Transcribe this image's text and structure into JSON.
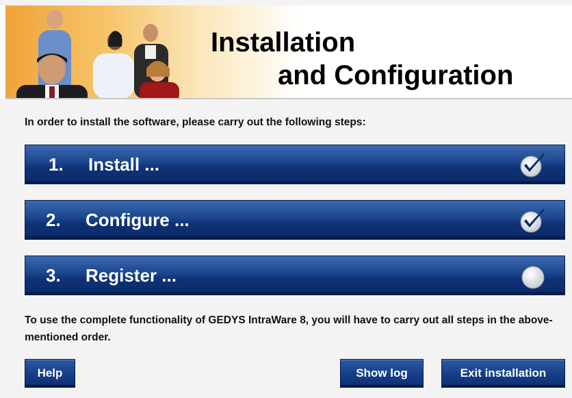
{
  "header": {
    "title_line1": "Installation",
    "title_line2": "and Configuration"
  },
  "intro": "In order to install the software, please carry out the following steps:",
  "steps": [
    {
      "number": "1.",
      "label": "Install ...",
      "status": "completed",
      "status_icon": "checkmark-icon"
    },
    {
      "number": "2.",
      "label": "Configure ...",
      "status": "completed",
      "status_icon": "checkmark-icon"
    },
    {
      "number": "3.",
      "label": "Register ...",
      "status": "pending",
      "status_icon": "empty-circle-icon"
    }
  ],
  "footer_text": "To use the complete functionality of GEDYS IntraWare 8, you will have to carry out all steps in the above-mentioned order.",
  "buttons": {
    "help": "Help",
    "show_log": "Show log",
    "exit": "Exit installation"
  },
  "colors": {
    "step_bar": "#1f4a91",
    "button": "#17408a",
    "checkmark": "#0b2a68"
  }
}
